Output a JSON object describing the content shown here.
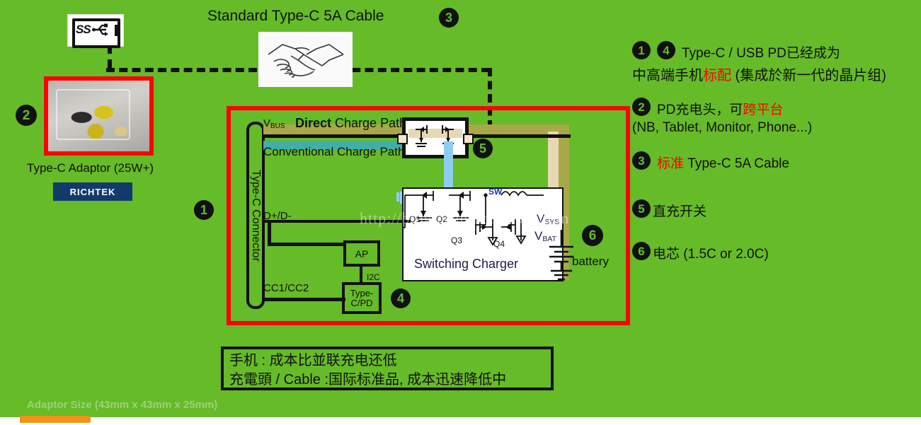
{
  "colors": {
    "background_green": "#66bb28",
    "accent_red": "#ff0000",
    "direct_path": "#a8a84a",
    "conventional_path": "#3fafa8",
    "blue_highlight": "#8fcdf0",
    "brand_blue": "#123a6b",
    "orange_bar": "#f29318"
  },
  "top": {
    "usb_logo_text": "SS",
    "usb_logo_name": "usb-superspeed-battery-logo",
    "cable_title": "Standard Type-C 5A Cable",
    "cable_badge": "3",
    "handshake_icon": "handshake-icon"
  },
  "adaptor": {
    "badge": "2",
    "label": "Type-C Adaptor (25W+)",
    "brand": "RICHTEK",
    "size_note": "Adaptor Size (43mm x 43mm x 25mm)"
  },
  "diagram": {
    "badge_phone": "1",
    "badge_pd": "4",
    "badge_switch": "5",
    "badge_battery": "6",
    "connector_label": "Type-C Connector",
    "vbus_label": "V",
    "vbus_sub": "BUS",
    "direct_path_label_bold": "Direct",
    "direct_path_label_rest": " Charge Path",
    "conventional_path_label": "Conventional Charge Path",
    "dpdm_label": "D+/D-",
    "cc_label": "CC1/CC2",
    "i2c_label": "I2C",
    "ap_label": "AP",
    "pd_label": "Type-C/PD",
    "charger_label": "Switching Charger",
    "sw_label": "SW",
    "q1": "Q1",
    "q2": "Q2",
    "q3": "Q3",
    "q4": "Q4",
    "vsys_label": "V",
    "vsys_sub": "SYS",
    "vbat_label": "V",
    "vbat_sub": "BAT",
    "battery_label": "battery",
    "watermark": "http://blog.csdn.net/zbosvnpin"
  },
  "bottom_box": {
    "line1": "手机 : 成本比並联充电还低",
    "line2": "充電頭 / Cable :国际标准品, 成本迅速降低中"
  },
  "notes": [
    {
      "badges": [
        "1",
        "4"
      ],
      "line1_plain": "Type-C / USB PD已经成为",
      "line2_pre": "中高端手机",
      "line2_red": "标配",
      "line2_post": " (集成於新一代的晶片组)"
    },
    {
      "badges": [
        "2"
      ],
      "line1_pre": "PD充电头，可",
      "line1_red": "跨平台",
      "line2_plain": "(NB, Tablet, Monitor, Phone...)"
    },
    {
      "badges": [
        "3"
      ],
      "line1_red": "标准",
      "line1_post": " Type-C 5A Cable"
    },
    {
      "badges": [
        "5"
      ],
      "line1_plain": "直充开关"
    },
    {
      "badges": [
        "6"
      ],
      "line1_plain": "电芯 (1.5C or 2.0C)"
    }
  ]
}
